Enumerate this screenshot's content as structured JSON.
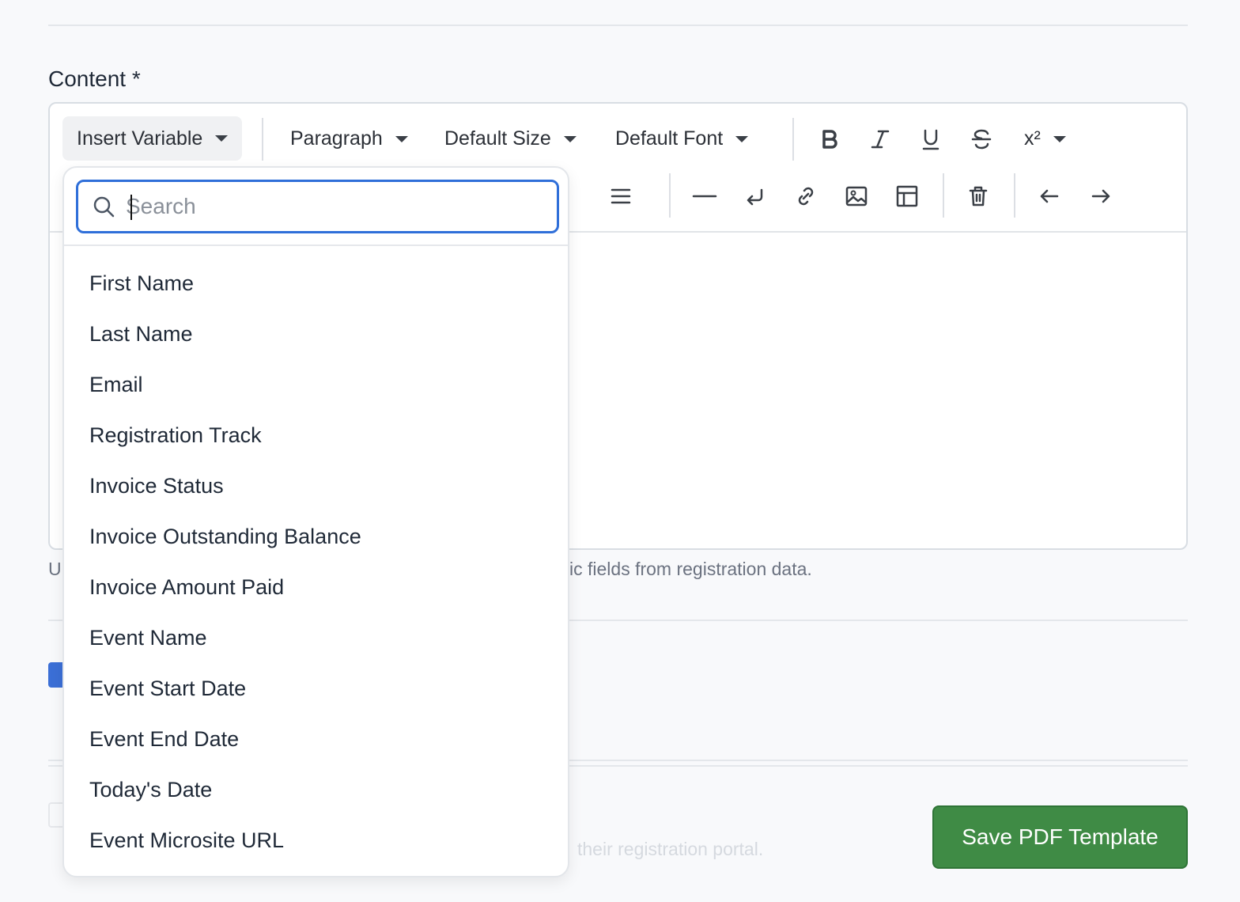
{
  "content_label": "Content *",
  "toolbar": {
    "insert_variable": "Insert Variable",
    "block_format": "Paragraph",
    "font_size": "Default Size",
    "font_family": "Default Font",
    "superscript": "x²"
  },
  "helper_text_left": "U",
  "helper_text_right": "ic fields from registration data.",
  "faded_text": "their registration portal.",
  "search": {
    "placeholder": "Search",
    "value": ""
  },
  "variables": [
    "First Name",
    "Last Name",
    "Email",
    "Registration Track",
    "Invoice Status",
    "Invoice Outstanding Balance",
    "Invoice Amount Paid",
    "Event Name",
    "Event Start Date",
    "Event End Date",
    "Today's Date",
    "Event Microsite URL"
  ],
  "save_button": "Save PDF Template",
  "colors": {
    "accent": "#2f6fd9",
    "save_button": "#3f8b45",
    "checkbox": "#3b6fd6"
  }
}
